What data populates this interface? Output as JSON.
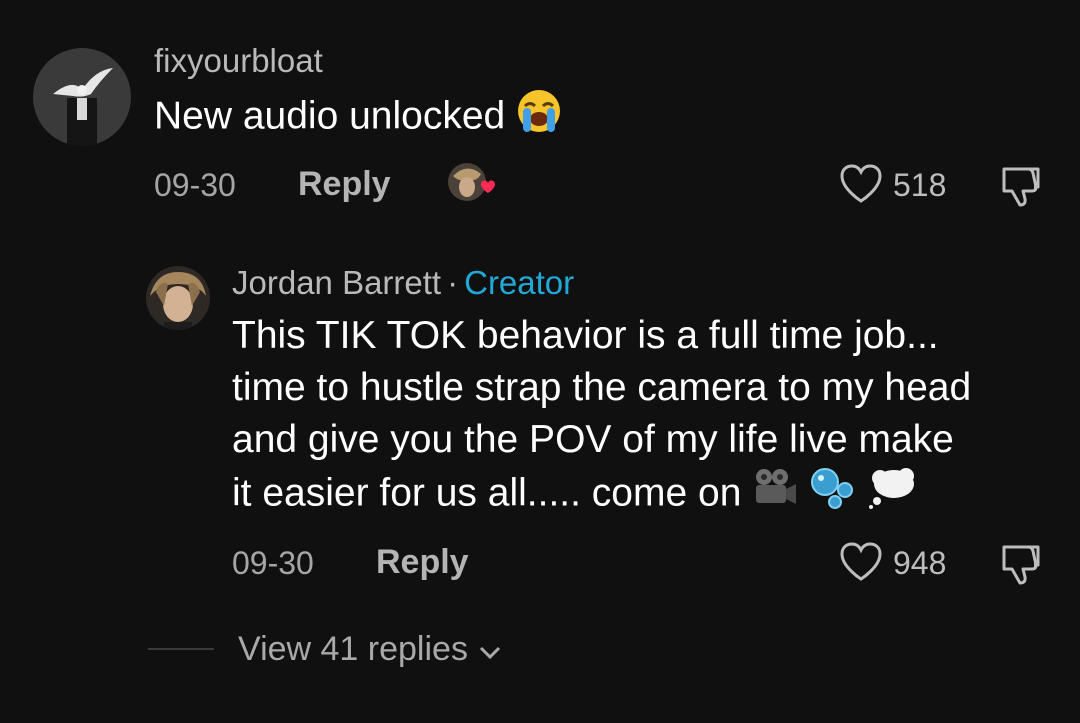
{
  "comment": {
    "username": "fixyourbloat",
    "text": "New audio unlocked",
    "emoji_icon": "loudly-crying-face-icon",
    "date": "09-30",
    "reply_label": "Reply",
    "likes": "518",
    "liked_by_creator_icon": "creator-heart-avatar-icon"
  },
  "reply": {
    "username": "Jordan Barrett",
    "separator": "·",
    "badge": "Creator",
    "lines": [
      "This TIK TOK behavior is a full time job...",
      "time to hustle strap the camera to my head",
      "and give you the POV of my life live make",
      "it easier for us all..... come on"
    ],
    "trailing_emoji_icons": [
      "film-projector-icon",
      "bubbles-icon",
      "thought-balloon-icon"
    ],
    "date": "09-30",
    "reply_label": "Reply",
    "likes": "948"
  },
  "view_replies": {
    "label": "View 41 replies"
  },
  "colors": {
    "background": "#101010",
    "creator_accent": "#22a8d6",
    "heart_badge": "#fe2c55"
  }
}
